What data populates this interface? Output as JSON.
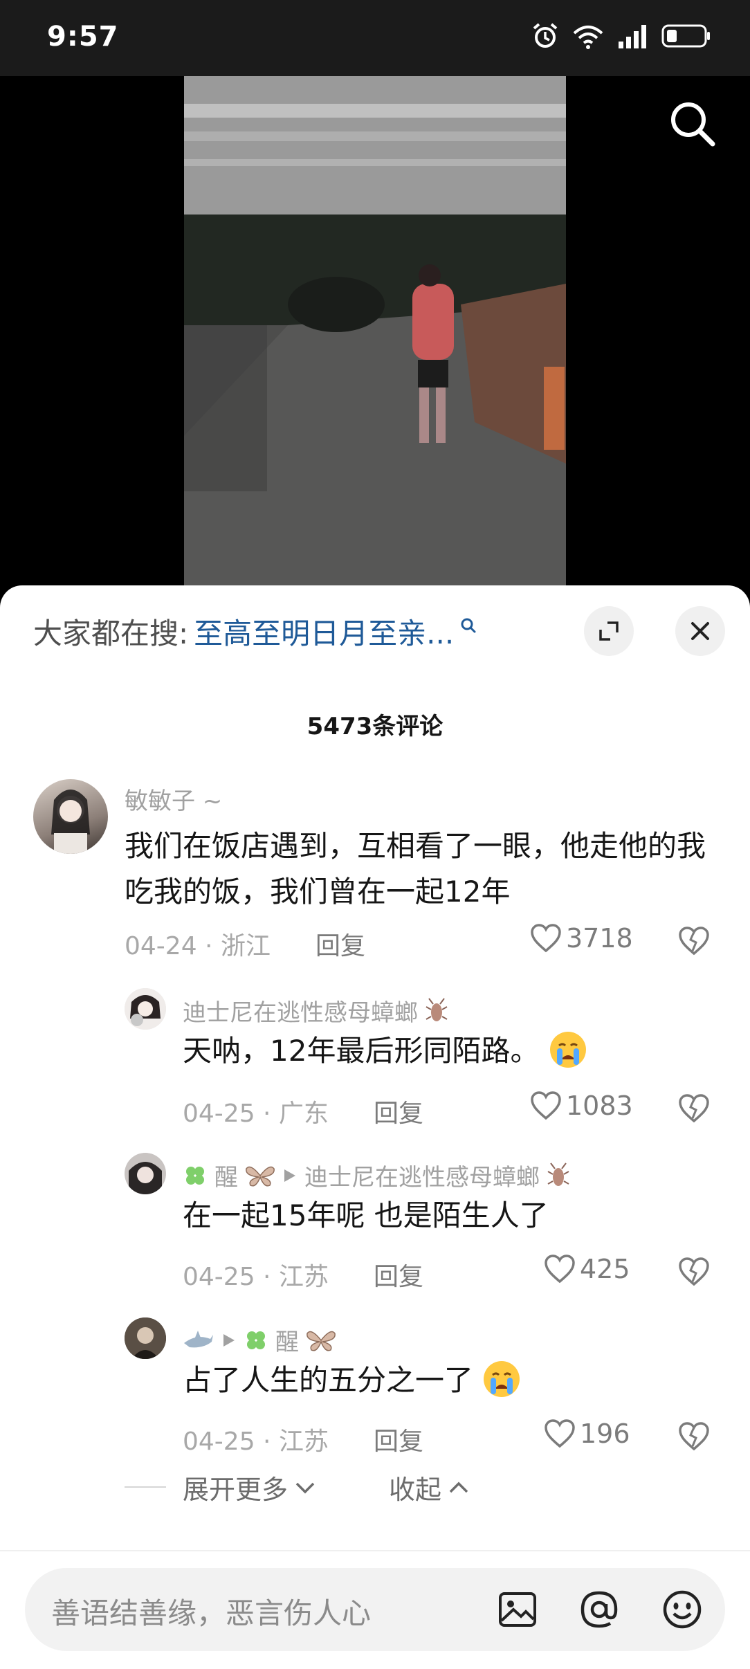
{
  "status_bar": {
    "time": "9:57"
  },
  "hot_search": {
    "prefix": "大家都在搜:",
    "term": "至高至明日月至亲..."
  },
  "comments_header": {
    "count_label": "5473条评论"
  },
  "comments": [
    {
      "username": "敏敏子 ~",
      "text": "我们在饭店遇到，互相看了一眼，他走他的我吃我的饭，我们曾在一起12年",
      "date": "04-24",
      "location": "浙江",
      "reply_label": "回复",
      "likes": "3718"
    }
  ],
  "replies": [
    {
      "username": "迪士尼在逃性感母蟑螂",
      "text": "天呐，12年最后形同陌路。",
      "date": "04-25",
      "location": "广东",
      "reply_label": "回复",
      "likes": "1083"
    },
    {
      "username": "醒",
      "reply_to": "迪士尼在逃性感母蟑螂",
      "text": "在一起15年呢 也是陌生人了",
      "date": "04-25",
      "location": "江苏",
      "reply_label": "回复",
      "likes": "425"
    },
    {
      "reply_to": "醒",
      "text": "占了人生的五分之一了",
      "date": "04-25",
      "location": "江苏",
      "reply_label": "回复",
      "likes": "196"
    }
  ],
  "expand": {
    "more_label": "展开更多",
    "collapse_label": "收起"
  },
  "input_bar": {
    "placeholder": "善语结善缘，恶言伤人心"
  },
  "icons": {
    "status": [
      "alarm-icon",
      "wifi-icon",
      "signal-icon",
      "battery-icon"
    ],
    "input": [
      "image-icon",
      "at-icon",
      "emoji-icon"
    ]
  },
  "colors": {
    "link_blue": "#1f5a98",
    "meta_gray": "#a8a8a8",
    "sheet_bg": "#ffffff"
  }
}
